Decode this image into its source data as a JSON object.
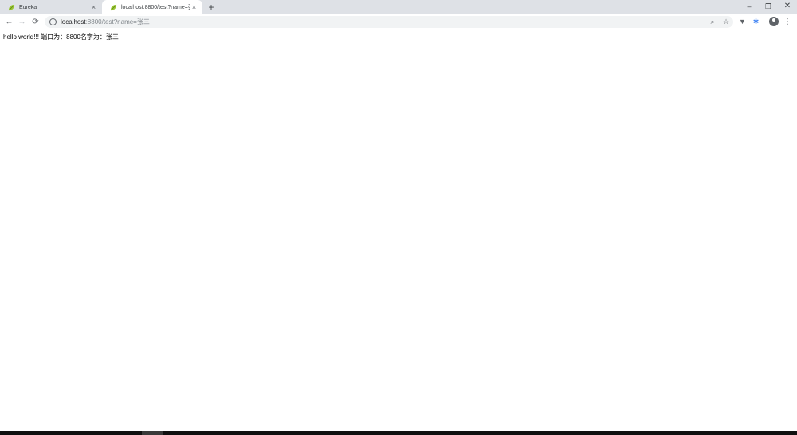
{
  "tabs": [
    {
      "title": "Eureka",
      "active": false
    },
    {
      "title": "localhost:8800/test?name=张三",
      "active": true
    }
  ],
  "tab_close_glyph": "×",
  "new_tab_glyph": "+",
  "window_controls": {
    "minimize": "–",
    "maximize": "❐",
    "close": "✕"
  },
  "toolbar": {
    "back": "←",
    "forward": "→",
    "reload": "⟳"
  },
  "address": {
    "info_glyph": "i",
    "host": "localhost",
    "rest": ":8800/test?name=张三"
  },
  "omnibox_icons": {
    "zoom": "⌕",
    "star": "☆"
  },
  "extensions": {
    "first": "▼",
    "second": "✱"
  },
  "menu_glyph": "⋮",
  "page": {
    "text": "hello world!!! 端口为：8800名字为：张三"
  },
  "colors": {
    "tabstrip": "#dee1e6",
    "omnibox": "#f1f3f4",
    "favicon_leaf": "#9ac934"
  }
}
